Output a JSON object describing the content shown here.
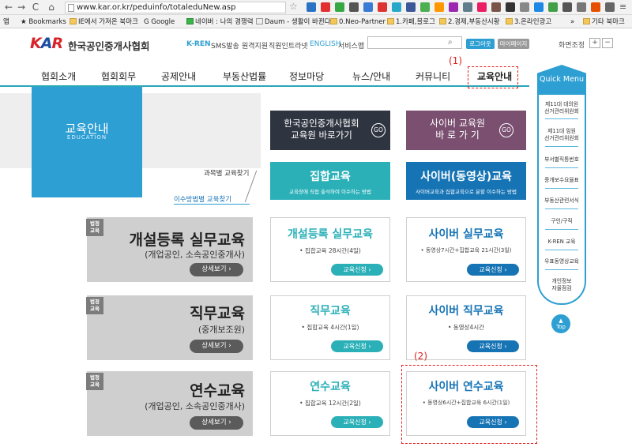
{
  "browser": {
    "url": "www.kar.or.kr/peduinfo/totaleduNew.asp",
    "bookmarks": [
      "앱",
      "Bookmarks",
      "IE에서 가져온 북마크",
      "Google",
      "네이버 : 나의 경쟁력",
      "Daum - 생활이 바뀐다",
      "0.Neo-Partner",
      "1.카페,블로그",
      "2.경제,부동산시황",
      "3.온라인광고",
      "기타 북마크"
    ],
    "bookmark_overflow": "»"
  },
  "header": {
    "logo_k": "K",
    "logo_a": "A",
    "logo_r": "R",
    "association_name": "한국공인중개사협회",
    "util_links": [
      "K-REN",
      "SMS발송",
      "원격지원",
      "직원인트라넷",
      "ENGLISH",
      "서비스맵"
    ],
    "logout": "로그아웃",
    "mypage": "마이페이지",
    "zoom_label": "화면조정"
  },
  "nav": {
    "items": [
      "협회소개",
      "협회회무",
      "공제안내",
      "부동산법률",
      "정보마당",
      "뉴스/안내",
      "커뮤니티",
      "교육안내"
    ],
    "annotation_1": "(1)"
  },
  "side": {
    "title": "교육안내",
    "subtitle": "EDUCATION",
    "link1": "과목별 교육찾기",
    "link2": "이수방법별 교육찾기",
    "badge": "법정\n교육",
    "courses": [
      {
        "title": "개설등록 실무교육",
        "sub": "(개업공인, 소속공인중개사)",
        "btn": "상세보기 ›"
      },
      {
        "title": "직무교육",
        "sub": "(중개보조원)",
        "btn": "상세보기 ›"
      },
      {
        "title": "연수교육",
        "sub": "(개업공인, 소속공인중개사)",
        "btn": "상세보기 ›"
      }
    ]
  },
  "banners": {
    "left_line1": "한국공인중개사협회",
    "left_line2": "교육원 바로가기",
    "right_line1": "사이버 교육원",
    "right_line2": "바 로 가 기",
    "go": "GO"
  },
  "columns": {
    "group_title": "집합교육",
    "group_desc": "교육장에 직접 출석하여 이수하는 방법",
    "cyber_title": "사이버(동영상)교육",
    "cyber_desc": "사이버교육과 집합교육으로 분할 이수하는 방법"
  },
  "cards": {
    "group": [
      {
        "title": "개설등록 실무교육",
        "desc": "• 집합교육 28시간(4일)",
        "btn": "교육신청 ›"
      },
      {
        "title": "직무교육",
        "desc": "• 집합교육 4시간(1일)",
        "btn": "교육신청 ›"
      },
      {
        "title": "연수교육",
        "desc": "• 집합교육 12시간(2일)",
        "btn": "교육신청 ›"
      }
    ],
    "cyber": [
      {
        "title": "사이버 실무교육",
        "desc": "• 동영상7시간+집합교육 21시간(3일)",
        "btn": "교육신청 ›"
      },
      {
        "title": "사이버 직무교육",
        "desc": "• 동영상4시간",
        "btn": "교육신청 ›"
      },
      {
        "title": "사이버 연수교육",
        "desc": "• 동영상6시간+집합교육 6시간(1일)",
        "btn": "교육신청 ›"
      }
    ],
    "annotation_2": "(2)"
  },
  "quick_menu": {
    "title": "Quick Menu",
    "items": [
      "제11대 대의원\n선거관리위원회",
      "제11대 임원\n선거관리위원회",
      "부서별직통번호",
      "중개보수요율표",
      "부동산관련서식",
      "구인/구직",
      "K-REN 교육",
      "우표동영상교육",
      "개인정보\n자율점검"
    ],
    "top": "Top"
  },
  "colors": {
    "teal": "#2bb0b8",
    "blue": "#1674b5",
    "sky": "#2e9fd3",
    "dark_banner": "#2f3540",
    "purple_banner": "#7a4f70",
    "annotation_red": "#e21d1d"
  }
}
